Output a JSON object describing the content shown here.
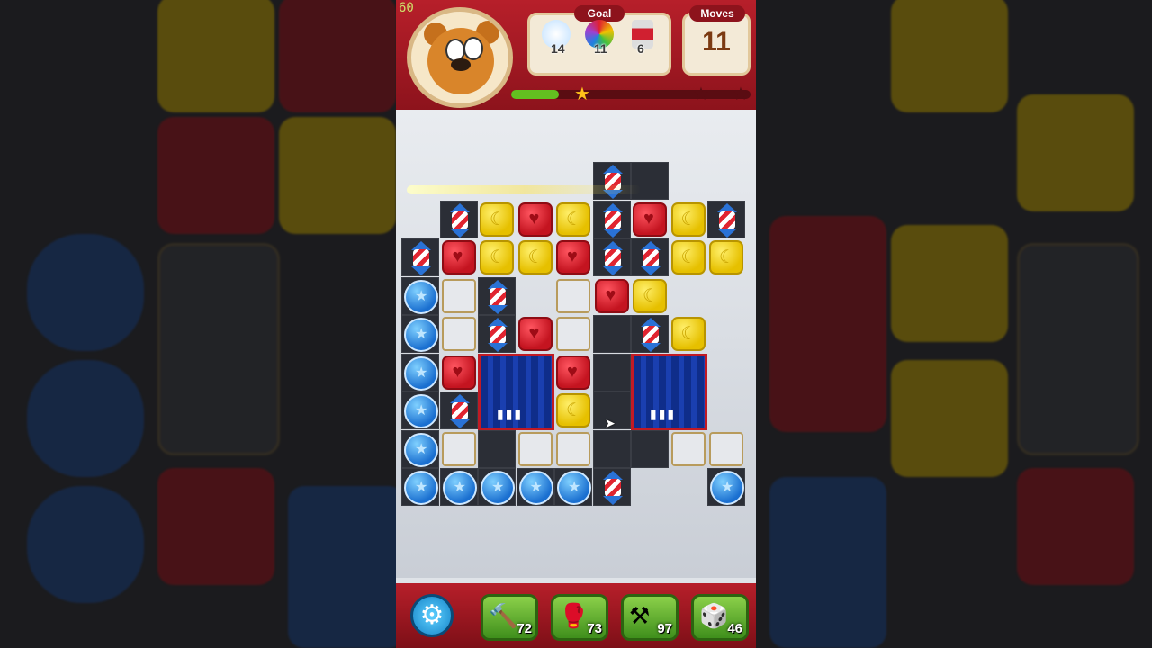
{
  "hud": {
    "fps": "60",
    "goal_title": "Goal",
    "moves_title": "Moves",
    "moves_value": "11",
    "goals": [
      {
        "icon": "bubble-goal-icon",
        "count": "14",
        "color": "#cfe8ff"
      },
      {
        "icon": "rainbow-ball-goal-icon",
        "count": "11",
        "color": "#e03aa0"
      },
      {
        "icon": "paint-can-goal-icon",
        "count": "6",
        "color": "#d02030"
      }
    ],
    "progress_fraction": 0.2,
    "stars": [
      "star-1-earned",
      "star-2",
      "star-3"
    ]
  },
  "colors": {
    "top_bar": "#b71f2a",
    "yellow_block": "#e6c000",
    "red_block": "#c41420",
    "bubble": "#1a6fd0",
    "progress": "#63c020"
  },
  "boosters": [
    {
      "name": "hammer-booster",
      "count": "72",
      "glyph": "🔨"
    },
    {
      "name": "glove-booster",
      "count": "73",
      "glyph": "🥊"
    },
    {
      "name": "drill-booster",
      "count": "97",
      "glyph": "⚒"
    },
    {
      "name": "dice-booster",
      "count": "46",
      "glyph": "🎲"
    }
  ],
  "settings_glyph": "⚙"
}
